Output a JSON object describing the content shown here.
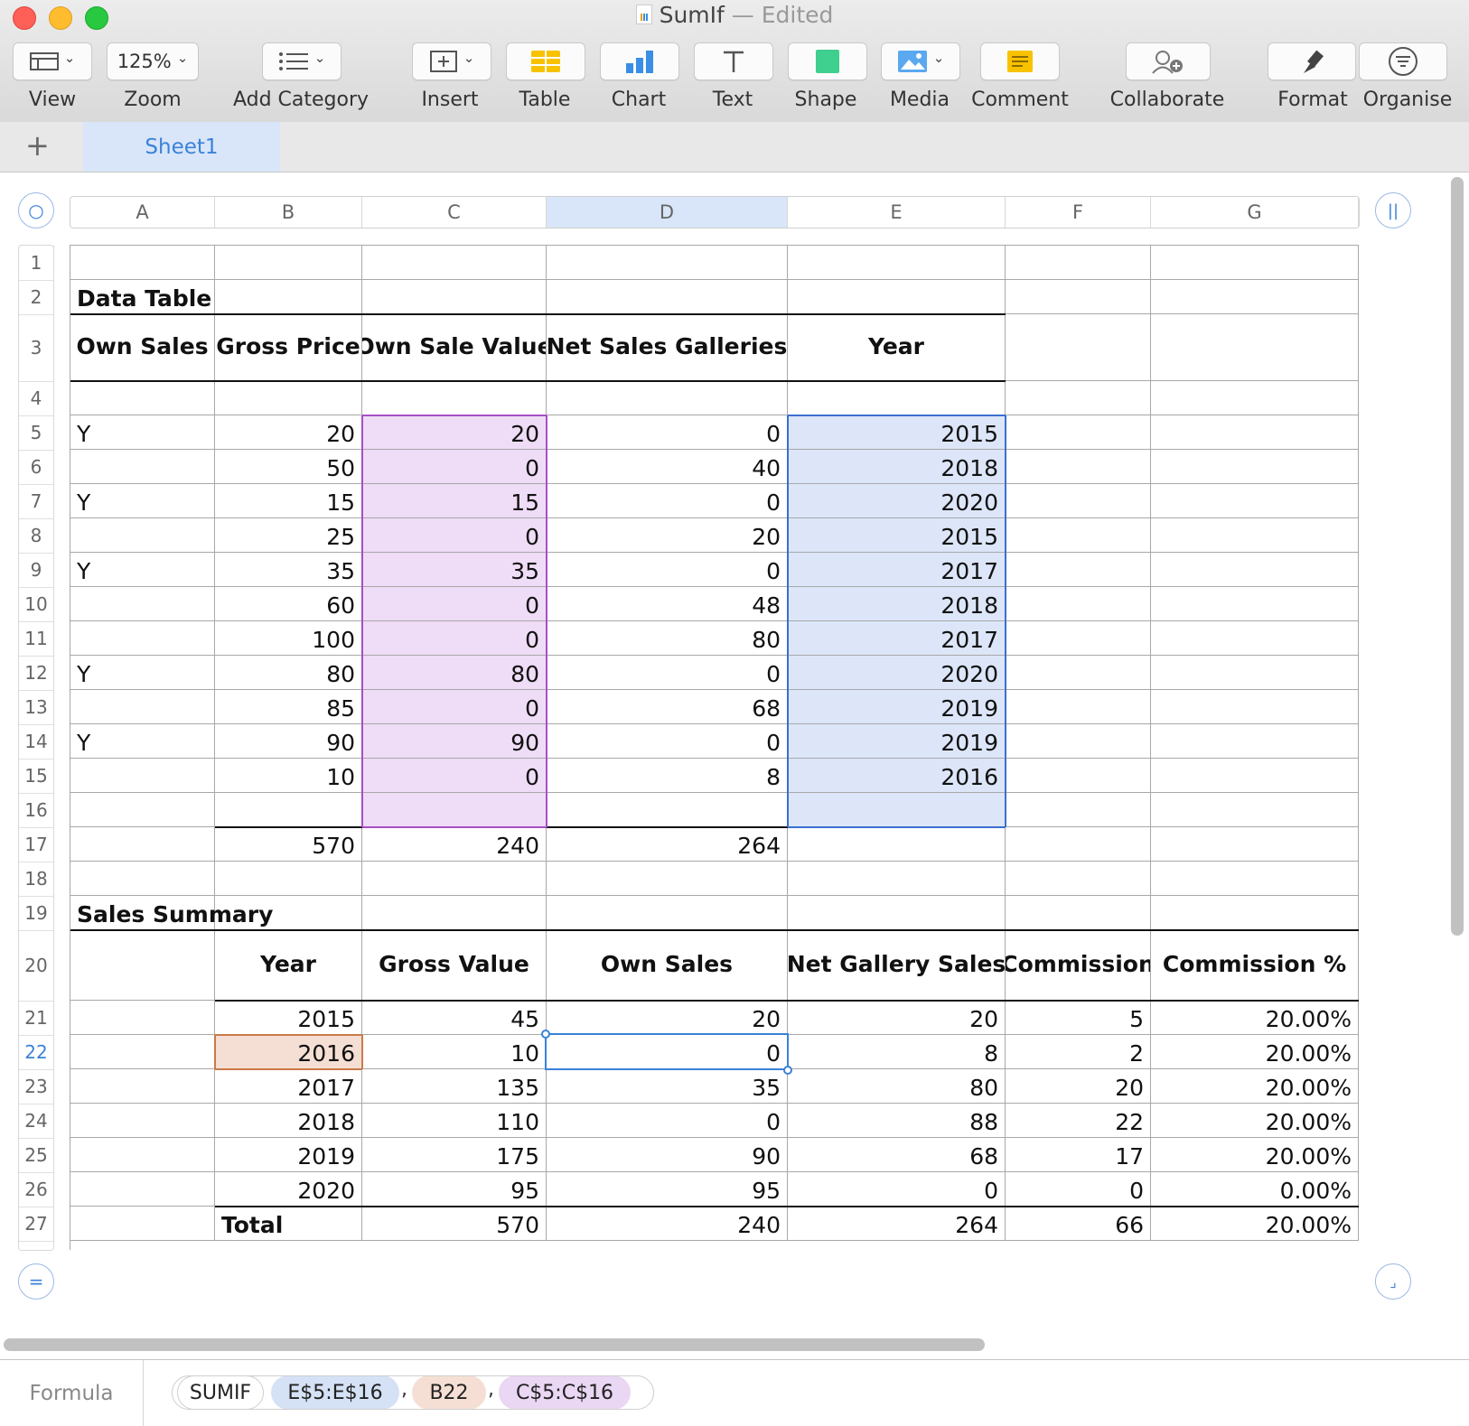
{
  "window": {
    "title": "SumIf",
    "status": "— Edited"
  },
  "toolbar": [
    {
      "id": "view",
      "label": "View",
      "icon": "sidebar-view-icon",
      "control": ""
    },
    {
      "id": "zoom",
      "label": "Zoom",
      "icon": "",
      "control": "125%"
    },
    {
      "id": "add-category",
      "label": "Add Category",
      "icon": "list-icon",
      "control": ""
    },
    {
      "id": "insert",
      "label": "Insert",
      "icon": "plus-box-icon",
      "control": ""
    },
    {
      "id": "table",
      "label": "Table",
      "icon": "table-icon",
      "control": ""
    },
    {
      "id": "chart",
      "label": "Chart",
      "icon": "bar-chart-icon",
      "control": ""
    },
    {
      "id": "text",
      "label": "Text",
      "icon": "text-icon",
      "control": ""
    },
    {
      "id": "shape",
      "label": "Shape",
      "icon": "shape-icon",
      "control": ""
    },
    {
      "id": "media",
      "label": "Media",
      "icon": "image-icon",
      "control": ""
    },
    {
      "id": "comment",
      "label": "Comment",
      "icon": "comment-icon",
      "control": ""
    },
    {
      "id": "collaborate",
      "label": "Collaborate",
      "icon": "collaborate-icon",
      "control": ""
    },
    {
      "id": "format",
      "label": "Format",
      "icon": "paintbrush-icon",
      "control": ""
    },
    {
      "id": "organise",
      "label": "Organise",
      "icon": "filter-icon",
      "control": ""
    }
  ],
  "sheets": {
    "add_icon": "+",
    "active": "Sheet1"
  },
  "columns": [
    "A",
    "B",
    "C",
    "D",
    "E",
    "F",
    "G"
  ],
  "selected_column": "D",
  "rows": [
    "1",
    "2",
    "3",
    "4",
    "5",
    "6",
    "7",
    "8",
    "9",
    "10",
    "11",
    "12",
    "13",
    "14",
    "15",
    "16",
    "17",
    "18",
    "19",
    "20",
    "21",
    "22",
    "23",
    "24",
    "25",
    "26",
    "27"
  ],
  "selected_row": "22",
  "cells": [
    [
      "",
      "",
      "",
      "",
      "",
      "",
      ""
    ],
    [
      "Data Table",
      "",
      "",
      "",
      "",
      "",
      ""
    ],
    [
      "Own Sales",
      "Gross Price",
      "Own Sale Value",
      "Net Sales Galleries",
      "Year",
      "",
      ""
    ],
    [
      "",
      "",
      "",
      "",
      "",
      "",
      ""
    ],
    [
      "Y",
      "20",
      "20",
      "0",
      "2015",
      "",
      ""
    ],
    [
      "",
      "50",
      "0",
      "40",
      "2018",
      "",
      ""
    ],
    [
      "Y",
      "15",
      "15",
      "0",
      "2020",
      "",
      ""
    ],
    [
      "",
      "25",
      "0",
      "20",
      "2015",
      "",
      ""
    ],
    [
      "Y",
      "35",
      "35",
      "0",
      "2017",
      "",
      ""
    ],
    [
      "",
      "60",
      "0",
      "48",
      "2018",
      "",
      ""
    ],
    [
      "",
      "100",
      "0",
      "80",
      "2017",
      "",
      ""
    ],
    [
      "Y",
      "80",
      "80",
      "0",
      "2020",
      "",
      ""
    ],
    [
      "",
      "85",
      "0",
      "68",
      "2019",
      "",
      ""
    ],
    [
      "Y",
      "90",
      "90",
      "0",
      "2019",
      "",
      ""
    ],
    [
      "",
      "10",
      "0",
      "8",
      "2016",
      "",
      ""
    ],
    [
      "",
      "",
      "",
      "",
      "",
      "",
      ""
    ],
    [
      "",
      "570",
      "240",
      "264",
      "",
      "",
      ""
    ],
    [
      "",
      "",
      "",
      "",
      "",
      "",
      ""
    ],
    [
      "Sales Summary",
      "",
      "",
      "",
      "",
      "",
      ""
    ],
    [
      "",
      "Year",
      "Gross Value",
      "Own Sales",
      "Net Gallery Sales",
      "Commission",
      "Commission %"
    ],
    [
      "",
      "2015",
      "45",
      "20",
      "20",
      "5",
      "20.00%"
    ],
    [
      "",
      "2016",
      "10",
      "0",
      "8",
      "2",
      "20.00%"
    ],
    [
      "",
      "2017",
      "135",
      "35",
      "80",
      "20",
      "20.00%"
    ],
    [
      "",
      "2018",
      "110",
      "0",
      "88",
      "22",
      "20.00%"
    ],
    [
      "",
      "2019",
      "175",
      "90",
      "68",
      "17",
      "20.00%"
    ],
    [
      "",
      "2020",
      "95",
      "95",
      "0",
      "0",
      "0.00%"
    ],
    [
      "",
      "Total",
      "570",
      "240",
      "264",
      "66",
      "20.00%"
    ]
  ],
  "formula": {
    "label": "Formula",
    "function": "SUMIF",
    "args": [
      "E$5:E$16",
      "B22",
      "C$5:C$16"
    ],
    "separator": ","
  },
  "colors": {
    "range_purple": "#efdcf6",
    "range_blue": "#dce6f8",
    "ref_peach": "#f5dfd4",
    "selection": "#3b82d8"
  }
}
